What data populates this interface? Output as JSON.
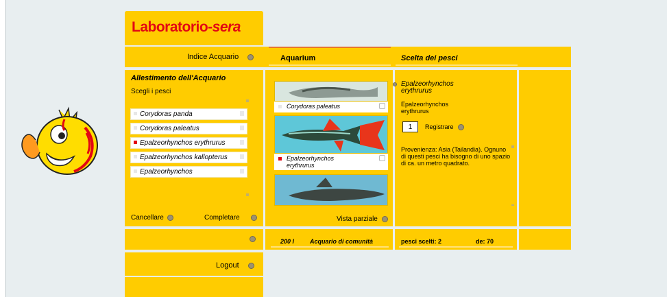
{
  "logo": {
    "main": "Laboratorio",
    "sep": "-",
    "brand": "sera"
  },
  "top": {
    "index_label": "Indice Acquario",
    "col1_title": "Aquarium",
    "col2_title": "Scelta dei pesci"
  },
  "left": {
    "title": "Allestimento dell'Acquario",
    "subtitle": "Scegli i pesci",
    "fish": [
      "Corydoras panda",
      "Corydoras paleatus",
      "Epalzeorhynchos erythrurus",
      "Epalzeorhynchos kallopterus",
      "Epalzeorhynchos"
    ],
    "cancel": "Cancellare",
    "complete": "Completare"
  },
  "mid": {
    "thumb1_caption": "Corydoras paleatus",
    "thumb2_caption": "Epalzeorhynchos erythrurus",
    "partial_view": "Vista parziale"
  },
  "detail": {
    "title": "Epalzeorhynchos erythrurus",
    "name": "Epalzeorhynchos erythrurus",
    "qty": "1",
    "register": "Registrare",
    "provenance": "Provenienza: Asia (Tailandia). Ognuno di questi pesci ha bisogno di uno spazio di ca. un metro quadrato."
  },
  "status": {
    "volume": "200 l",
    "type": "Acquario di comunità",
    "chosen": "pesci scelti: 2",
    "max": "de: 70"
  },
  "logout": "Logout",
  "colors": {
    "yellow": "#ffcc00",
    "red": "#e30613",
    "bg": "#e8eef0"
  }
}
